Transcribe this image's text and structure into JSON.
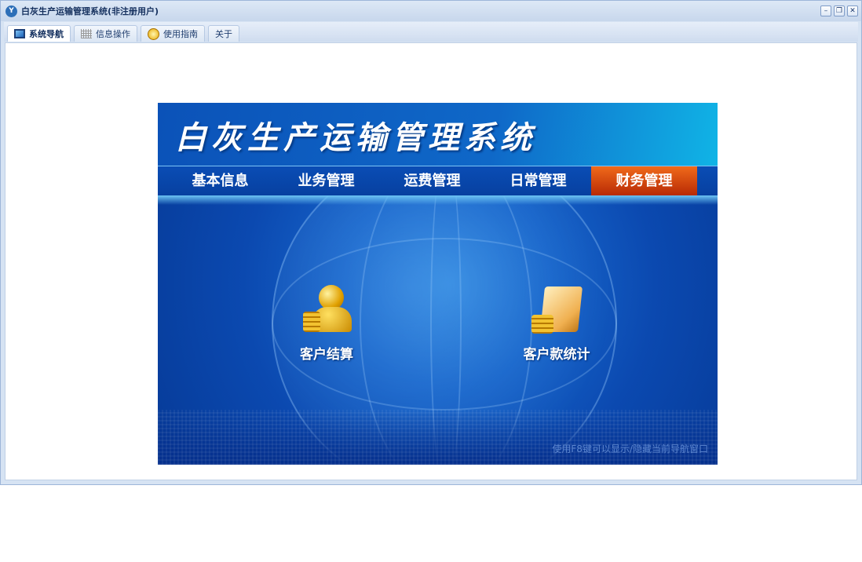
{
  "window": {
    "title": "白灰生产运输管理系统(非注册用户)",
    "minimize": "–",
    "restore": "❐",
    "close": "✕"
  },
  "tabs": [
    {
      "label": "系统导航",
      "icon": "monitor-icon"
    },
    {
      "label": "信息操作",
      "icon": "grid-icon"
    },
    {
      "label": "使用指南",
      "icon": "help-icon"
    },
    {
      "label": "关于"
    }
  ],
  "banner": {
    "title": "白灰生产运输管理系统",
    "menu": [
      "基本信息",
      "业务管理",
      "运费管理",
      "日常管理",
      "财务管理"
    ],
    "active_menu": "财务管理",
    "items": [
      {
        "label": "客户结算",
        "icon": "coin-person-icon"
      },
      {
        "label": "客户款统计",
        "icon": "folder-coins-icon"
      }
    ],
    "hint": "使用F8键可以显示/隐藏当前导航窗口"
  }
}
